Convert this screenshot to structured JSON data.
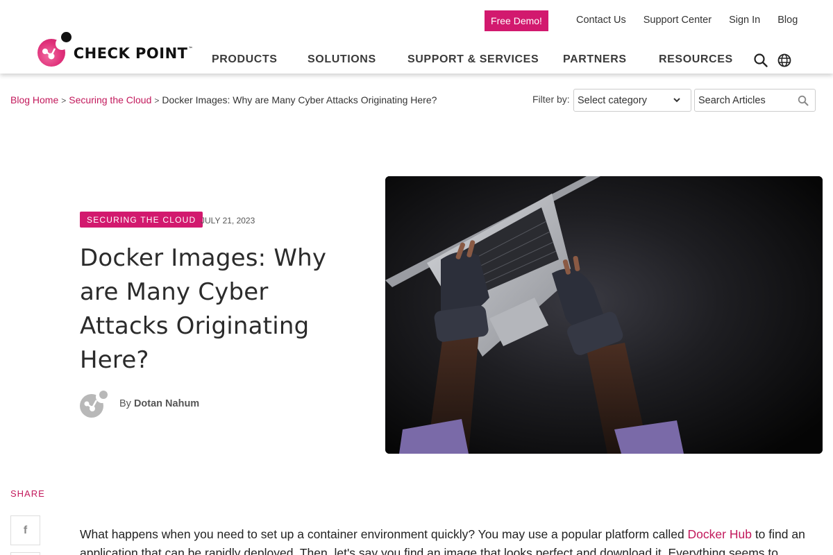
{
  "brand": {
    "name": "CHECK POINT",
    "trademark": "™",
    "accent_color": "#d2196e",
    "link_color": "#c2185b"
  },
  "header": {
    "free_demo_label": "Free Demo!",
    "utility_links": [
      "Contact Us",
      "Support Center",
      "Sign In",
      "Blog"
    ],
    "nav": [
      "PRODUCTS",
      "SOLUTIONS",
      "SUPPORT & SERVICES",
      "PARTNERS",
      "RESOURCES"
    ],
    "icons": [
      "search-icon",
      "globe-icon"
    ]
  },
  "breadcrumb": {
    "items": [
      "Blog Home",
      "Securing the Cloud",
      "Docker Images: Why are Many Cyber Attacks Originating Here?"
    ],
    "separator": ">"
  },
  "filter": {
    "label": "Filter by:",
    "category_selected": "Select category",
    "search_placeholder": "Search Articles"
  },
  "post": {
    "category": "SECURING THE CLOUD",
    "date": "JULY 21, 2023",
    "title": "Docker Images: Why are Many Cyber Attacks Originating Here?",
    "author_prefix": "By",
    "author_name": "Dotan Nahum",
    "hero_image_alt": "Gloved hands typing on a laptop in the dark"
  },
  "share": {
    "label": "SHARE",
    "buttons": [
      "facebook"
    ]
  },
  "body": {
    "p1_before_link": "What happens when you need to set up a container environment quickly? You may use a popular platform called ",
    "p1_link": "Docker Hub",
    "p1_after_link": " to find",
    "p1_line2": "an application that can be rapidly deployed. Then, let's say you find an image that looks perfect and download it. Everything seems to"
  }
}
